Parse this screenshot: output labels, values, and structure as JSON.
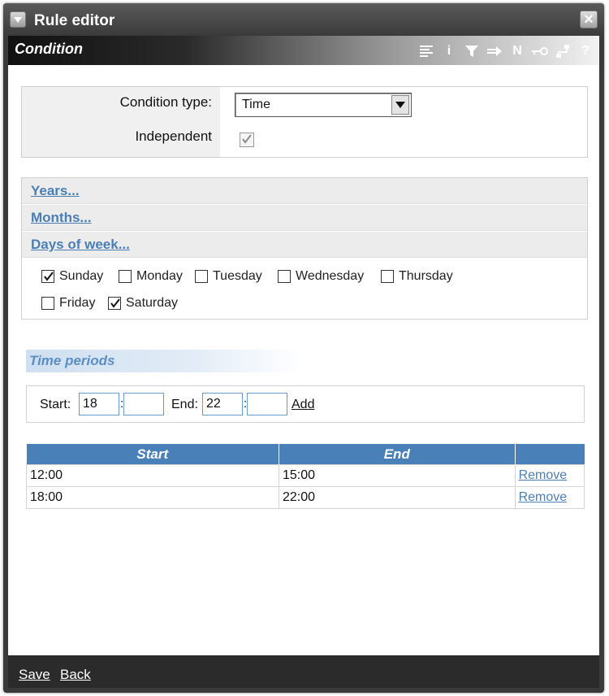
{
  "window": {
    "title": "Rule editor"
  },
  "section": {
    "title": "Condition"
  },
  "toolbar": {
    "icons": [
      "list-icon",
      "info-icon",
      "filter-icon",
      "arrow-right-icon",
      "n-icon",
      "key-icon",
      "network-icon",
      "help-icon"
    ],
    "n_label": "N",
    "help_label": "?",
    "info_label": "i"
  },
  "condition": {
    "type_label": "Condition type:",
    "type_value": "Time",
    "independent_label": "Independent",
    "independent_checked": true
  },
  "dates": {
    "years_label": "Years...",
    "months_label": "Months...",
    "days_label": "Days of week...",
    "days": [
      {
        "label": "Sunday",
        "checked": true
      },
      {
        "label": "Monday",
        "checked": false
      },
      {
        "label": "Tuesday",
        "checked": false
      },
      {
        "label": "Wednesday",
        "checked": false
      },
      {
        "label": "Thursday",
        "checked": false
      },
      {
        "label": "Friday",
        "checked": false
      },
      {
        "label": "Saturday",
        "checked": true
      }
    ]
  },
  "time_periods": {
    "title": "Time periods",
    "start_label": "Start:",
    "end_label": "End:",
    "start_hour": "18",
    "start_min": "",
    "end_hour": "22",
    "end_min": "",
    "colon": ":",
    "add_label": "Add"
  },
  "table": {
    "headers": [
      "Start",
      "End",
      ""
    ],
    "rows": [
      {
        "start": "12:00",
        "end": "15:00",
        "action": "Remove"
      },
      {
        "start": "18:00",
        "end": "22:00",
        "action": "Remove"
      }
    ]
  },
  "footer": {
    "save_label": "Save",
    "back_label": "Back"
  },
  "colors": {
    "accent": "#4a80b8",
    "link": "#4a7fb5",
    "chrome": "#3a3a3a"
  }
}
